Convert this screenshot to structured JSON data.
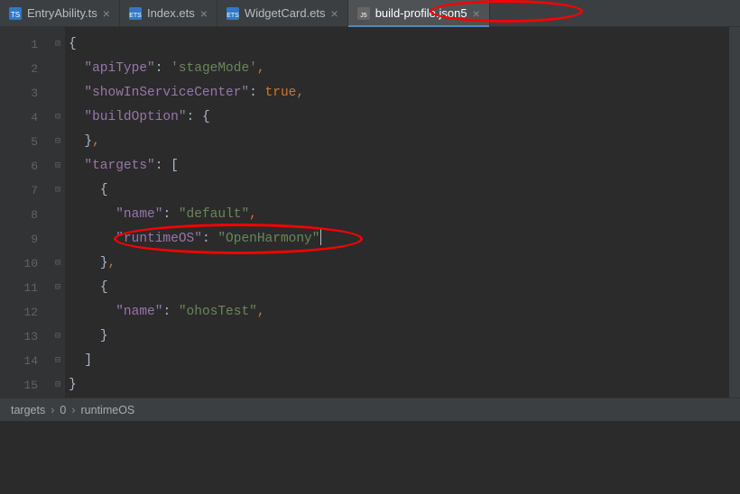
{
  "tabs": [
    {
      "label": "EntryAbility.ts",
      "icon": "ts"
    },
    {
      "label": "Index.ets",
      "icon": "ets"
    },
    {
      "label": "WidgetCard.ets",
      "icon": "ets"
    },
    {
      "label": "build-profile.json5",
      "icon": "json5",
      "active": true
    }
  ],
  "gutter": [
    "1",
    "2",
    "3",
    "4",
    "5",
    "6",
    "7",
    "8",
    "9",
    "10",
    "11",
    "12",
    "13",
    "14",
    "15"
  ],
  "code": {
    "l1_open": "{",
    "l2_key": "\"apiType\"",
    "l2_colon": ": ",
    "l2_val": "'stageMode'",
    "l2_comma": ",",
    "l3_key": "\"showInServiceCenter\"",
    "l3_colon": ": ",
    "l3_val": "true",
    "l3_comma": ",",
    "l4_key": "\"buildOption\"",
    "l4_colon": ": ",
    "l4_open": "{",
    "l5_close": "}",
    "l5_comma": ",",
    "l6_key": "\"targets\"",
    "l6_colon": ": ",
    "l6_open": "[",
    "l7_open": "{",
    "l8_key": "\"name\"",
    "l8_colon": ": ",
    "l8_val": "\"default\"",
    "l8_comma": ",",
    "l9_key": "\"runtimeOS\"",
    "l9_colon": ": ",
    "l9_val": "\"OpenHarmony\"",
    "l10_close": "}",
    "l10_comma": ",",
    "l11_open": "{",
    "l12_key": "\"name\"",
    "l12_colon": ": ",
    "l12_val": "\"ohosTest\"",
    "l12_comma": ",",
    "l13_close": "}",
    "l14_close": "]",
    "l15_close": "}"
  },
  "breadcrumb": [
    "targets",
    "0",
    "runtimeOS"
  ]
}
